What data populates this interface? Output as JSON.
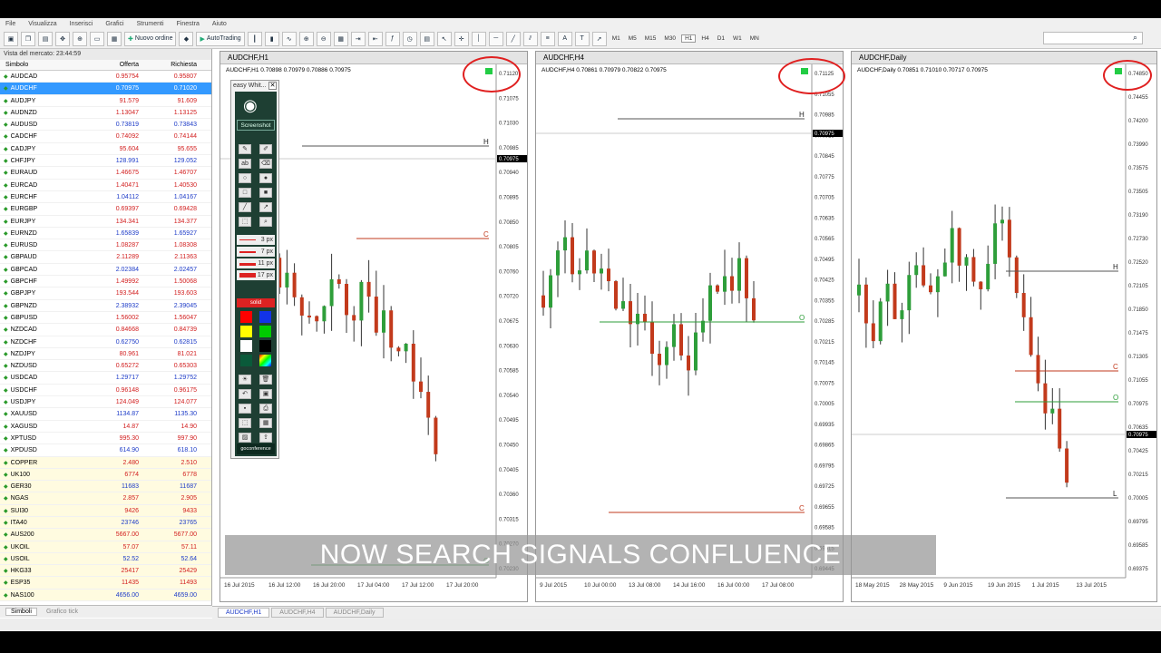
{
  "menu": [
    "File",
    "Visualizza",
    "Inserisci",
    "Grafici",
    "Strumenti",
    "Finestra",
    "Aiuto"
  ],
  "toolbar": {
    "new_order": "Nuovo ordine",
    "autotrading": "AutoTrading",
    "timeframes": [
      "M1",
      "M5",
      "M15",
      "M30",
      "H1",
      "H4",
      "D1",
      "W1",
      "MN"
    ]
  },
  "market_watch": {
    "title": "Vista del mercato: 23:44:59",
    "headers": [
      "Simbolo",
      "Offerta",
      "Richiesta"
    ],
    "rows": [
      [
        "AUDCAD",
        "0.95754",
        "0.95807"
      ],
      [
        "AUDCHF",
        "0.70975",
        "0.71020"
      ],
      [
        "AUDJPY",
        "91.579",
        "91.609"
      ],
      [
        "AUDNZD",
        "1.13047",
        "1.13125"
      ],
      [
        "AUDUSD",
        "0.73819",
        "0.73843"
      ],
      [
        "CADCHF",
        "0.74092",
        "0.74144"
      ],
      [
        "CADJPY",
        "95.604",
        "95.655"
      ],
      [
        "CHFJPY",
        "128.991",
        "129.052"
      ],
      [
        "EURAUD",
        "1.46675",
        "1.46707"
      ],
      [
        "EURCAD",
        "1.40471",
        "1.40530"
      ],
      [
        "EURCHF",
        "1.04112",
        "1.04167"
      ],
      [
        "EURGBP",
        "0.69397",
        "0.69428"
      ],
      [
        "EURJPY",
        "134.341",
        "134.377"
      ],
      [
        "EURNZD",
        "1.65839",
        "1.65927"
      ],
      [
        "EURUSD",
        "1.08287",
        "1.08308"
      ],
      [
        "GBPAUD",
        "2.11289",
        "2.11363"
      ],
      [
        "GBPCAD",
        "2.02384",
        "2.02457"
      ],
      [
        "GBPCHF",
        "1.49992",
        "1.50068"
      ],
      [
        "GBPJPY",
        "193.544",
        "193.603"
      ],
      [
        "GBPNZD",
        "2.38932",
        "2.39045"
      ],
      [
        "GBPUSD",
        "1.56002",
        "1.56047"
      ],
      [
        "NZDCAD",
        "0.84668",
        "0.84739"
      ],
      [
        "NZDCHF",
        "0.62750",
        "0.62815"
      ],
      [
        "NZDJPY",
        "80.961",
        "81.021"
      ],
      [
        "NZDUSD",
        "0.65272",
        "0.65303"
      ],
      [
        "USDCAD",
        "1.29717",
        "1.29752"
      ],
      [
        "USDCHF",
        "0.96148",
        "0.96175"
      ],
      [
        "USDJPY",
        "124.049",
        "124.077"
      ],
      [
        "XAUUSD",
        "1134.87",
        "1135.30"
      ],
      [
        "XAGUSD",
        "14.87",
        "14.90"
      ],
      [
        "XPTUSD",
        "995.30",
        "997.90"
      ],
      [
        "XPDUSD",
        "614.90",
        "618.10"
      ],
      [
        "COPPER",
        "2.480",
        "2.510"
      ],
      [
        "UK100",
        "6774",
        "6778"
      ],
      [
        "GER30",
        "11683",
        "11687"
      ],
      [
        "NGAS",
        "2.857",
        "2.905"
      ],
      [
        "SUI30",
        "9426",
        "9433"
      ],
      [
        "ITA40",
        "23746",
        "23765"
      ],
      [
        "AUS200",
        "5667.00",
        "5677.00"
      ],
      [
        "UKOIL",
        "57.07",
        "57.11"
      ],
      [
        "USOIL",
        "52.52",
        "52.64"
      ],
      [
        "HKG33",
        "25417",
        "25429"
      ],
      [
        "ESP35",
        "11435",
        "11493"
      ],
      [
        "NAS100",
        "4656.00",
        "4659.00"
      ]
    ],
    "tabs": [
      "Simboli",
      "Grafico tick"
    ]
  },
  "easy_white": {
    "title": "easy Whit...",
    "screenshot": "Screenshot",
    "sizes": [
      "3 px",
      "7 px",
      "11 px",
      "17 px"
    ],
    "style": "solid",
    "footer": "goconference"
  },
  "charts": [
    {
      "title": "AUDCHF,H1",
      "info": "AUDCHF,H1  0.70898 0.70979 0.70886 0.70975",
      "prices": [
        "0.71120",
        "0.71075",
        "0.71030",
        "0.70985",
        "0.70940",
        "0.70895",
        "0.70850",
        "0.70805",
        "0.70760",
        "0.70720",
        "0.70675",
        "0.70630",
        "0.70585",
        "0.70540",
        "0.70495",
        "0.70450",
        "0.70405",
        "0.70360",
        "0.70315",
        "0.70270",
        "0.70230"
      ],
      "current": "0.70975",
      "dates": [
        "16 Jul 2015",
        "16 Jul 12:00",
        "16 Jul 20:00",
        "17 Jul 04:00",
        "17 Jul 12:00",
        "17 Jul 20:00"
      ],
      "levels": [
        "H",
        "C",
        "O",
        "L"
      ]
    },
    {
      "title": "AUDCHF,H4",
      "info": "AUDCHF,H4  0.70861 0.70979 0.70822 0.70975",
      "prices": [
        "0.71125",
        "0.71055",
        "0.70985",
        "0.70915",
        "0.70845",
        "0.70775",
        "0.70705",
        "0.70635",
        "0.70565",
        "0.70495",
        "0.70425",
        "0.70355",
        "0.70285",
        "0.70215",
        "0.70145",
        "0.70075",
        "0.70005",
        "0.69935",
        "0.69865",
        "0.69795",
        "0.69725",
        "0.69655",
        "0.69585",
        "0.69515",
        "0.69445"
      ],
      "current": "0.70975",
      "dates": [
        "9 Jul 2015",
        "10 Jul 00:00",
        "13 Jul 08:00",
        "14 Jul 16:00",
        "16 Jul 00:00",
        "17 Jul 08:00"
      ],
      "levels": [
        "H",
        "O",
        "C",
        "L"
      ]
    },
    {
      "title": "AUDCHF,Daily",
      "info": "AUDCHF,Daily  0.70851 0.71010 0.70717 0.70975",
      "prices": [
        "0.74850",
        "0.74455",
        "0.74200",
        "0.73990",
        "0.73575",
        "0.73505",
        "0.73190",
        "0.72730",
        "0.72520",
        "0.72105",
        "0.71850",
        "0.71475",
        "0.71305",
        "0.71055",
        "0.70975",
        "0.70635",
        "0.70425",
        "0.70215",
        "0.70005",
        "0.69795",
        "0.69585",
        "0.69375"
      ],
      "current": "0.70975",
      "dates": [
        "18 May 2015",
        "28 May 2015",
        "9 Jun 2015",
        "19 Jun 2015",
        "1 Jul 2015",
        "13 Jul 2015"
      ],
      "levels": [
        "H",
        "C",
        "O",
        "L"
      ]
    }
  ],
  "bottom_tabs": [
    "AUDCHF,H1",
    "AUDCHF,H4",
    "AUDCHF,Daily"
  ],
  "overlay": "NOW SEARCH SIGNALS CONFLUENCE",
  "colors": {
    "bull": "#2e9e3a",
    "bear": "#c23a1c",
    "selection": "#3399ff",
    "annotation": "#e02020"
  }
}
